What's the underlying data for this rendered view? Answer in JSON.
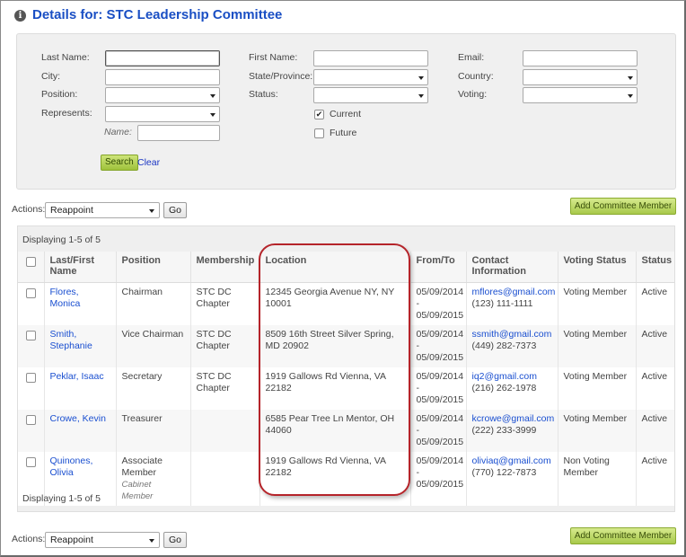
{
  "header": {
    "title": "Details for: STC Leadership Committee",
    "icon": "info-icon"
  },
  "search": {
    "last_name_label": "Last Name:",
    "first_name_label": "First Name:",
    "email_label": "Email:",
    "city_label": "City:",
    "state_label": "State/Province:",
    "country_label": "Country:",
    "position_label": "Position:",
    "status_label": "Status:",
    "voting_label": "Voting:",
    "represents_label": "Represents:",
    "name_label": "Name:",
    "current_label": "Current",
    "current_checked": true,
    "future_label": "Future",
    "future_checked": false,
    "search_button": "Search",
    "clear_link": "Clear"
  },
  "actions": {
    "label": "Actions:",
    "selected": "Reappoint",
    "go": "Go",
    "add_button": "Add Committee Member"
  },
  "grid": {
    "display_top": "Displaying 1-5 of 5",
    "display_bottom": "Displaying 1-5 of 5",
    "columns": [
      "Last/First Name",
      "Position",
      "Membership",
      "Location",
      "From/To",
      "Contact Information",
      "Voting Status",
      "Status"
    ],
    "rows": [
      {
        "name": "Flores, Monica",
        "position": "Chairman",
        "position_sub": "",
        "membership": "STC DC Chapter",
        "location": "12345 Georgia Avenue NY, NY 10001",
        "from": "05/09/2014",
        "dash": "-",
        "to": "05/09/2015",
        "email": "mflores@gmail.com",
        "phone": "(123) 111-1111",
        "voting": "Voting Member",
        "status": "Active"
      },
      {
        "name": "Smith, Stephanie",
        "position": "Vice Chairman",
        "position_sub": "",
        "membership": "STC DC Chapter",
        "location": "8509 16th Street Silver Spring, MD 20902",
        "from": "05/09/2014",
        "dash": "-",
        "to": "05/09/2015",
        "email": "ssmith@gmail.com",
        "phone": "(449) 282-7373",
        "voting": "Voting Member",
        "status": "Active"
      },
      {
        "name": "Peklar, Isaac",
        "position": "Secretary",
        "position_sub": "",
        "membership": "STC DC Chapter",
        "location": "1919 Gallows Rd Vienna, VA 22182",
        "from": "05/09/2014",
        "dash": "-",
        "to": "05/09/2015",
        "email": "iq2@gmail.com",
        "phone": "(216) 262-1978",
        "voting": "Voting Member",
        "status": "Active"
      },
      {
        "name": "Crowe, Kevin",
        "position": "Treasurer",
        "position_sub": "",
        "membership": "",
        "location": "6585 Pear Tree Ln Mentor, OH 44060",
        "from": "05/09/2014",
        "dash": "-",
        "to": "05/09/2015",
        "email": "kcrowe@gmail.com",
        "phone": "(222) 233-3999",
        "voting": "Voting Member",
        "status": "Active"
      },
      {
        "name": "Quinones, Olivia",
        "position": "Associate Member",
        "position_sub": "Cabinet Member",
        "membership": "",
        "location": "1919 Gallows Rd Vienna, VA 22182",
        "from": "05/09/2014",
        "dash": "-",
        "to": "05/09/2015",
        "email": "oliviaq@gmail.com",
        "phone": "(770) 122-7873",
        "voting": "Non Voting Member",
        "status": "Active"
      }
    ]
  },
  "colors": {
    "title": "#1a4fc4",
    "link": "#1a4fd0",
    "add_button": "#a8c94b",
    "highlight": "#b5242a"
  }
}
